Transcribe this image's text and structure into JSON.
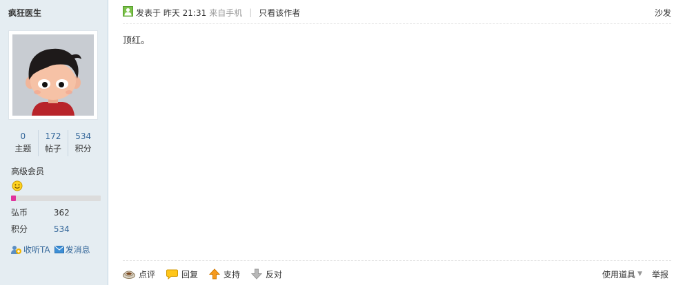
{
  "user": {
    "name": "疯狂医生",
    "stats": [
      {
        "value": "0",
        "label": "主题"
      },
      {
        "value": "172",
        "label": "帖子"
      },
      {
        "value": "534",
        "label": "积分"
      }
    ],
    "group": "高级会员",
    "level_progress": 0.05,
    "info": [
      {
        "key": "弘币",
        "value": "362"
      },
      {
        "key": "积分",
        "value": "534"
      }
    ],
    "actions": {
      "follow": "收听TA",
      "message": "发消息"
    }
  },
  "post": {
    "posted": "发表于 昨天 21:31",
    "device": "来自手机",
    "author_only": "只看该作者",
    "floor": "沙发",
    "content": "顶红。"
  },
  "footer": {
    "comment": "点评",
    "reply": "回复",
    "support": "支持",
    "oppose": "反对",
    "tools": "使用道具",
    "report": "举报"
  },
  "colors": {
    "sidebar_bg": "#e5edf2",
    "link": "#336699",
    "progress": "#e0329d"
  }
}
